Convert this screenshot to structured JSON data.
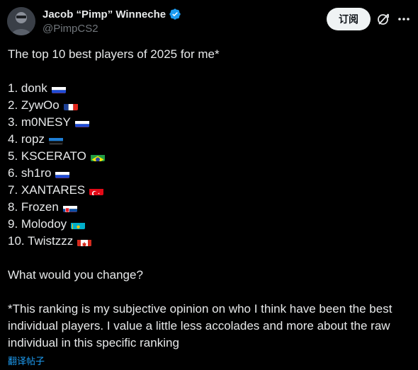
{
  "author": {
    "display_name": "Jacob “Pimp” Winneche",
    "handle": "@PimpCS2",
    "verified_icon": "verified-badge-icon"
  },
  "actions": {
    "subscribe_label": "订阅",
    "grok_icon": "grok-icon",
    "more_icon": "more-icon"
  },
  "post": {
    "intro": "The top 10 best players of 2025 for me*",
    "ranking": [
      {
        "text": "1. donk",
        "flag": "russia"
      },
      {
        "text": "2. ZywOo",
        "flag": "france"
      },
      {
        "text": "3. m0NESY",
        "flag": "russia"
      },
      {
        "text": "4. ropz",
        "flag": "estonia"
      },
      {
        "text": "5. KSCERATO",
        "flag": "brazil"
      },
      {
        "text": "6. sh1ro",
        "flag": "russia"
      },
      {
        "text": "7. XANTARES",
        "flag": "turkey"
      },
      {
        "text": "8. Frozen",
        "flag": "slovakia"
      },
      {
        "text": "9. Molodoy",
        "flag": "kazakhstan"
      },
      {
        "text": "10. Twistzzz",
        "flag": "canada"
      }
    ],
    "question": "What would you change?",
    "footnote": "*This ranking is my subjective opinion on who I think have been the best individual players. I value a little less accolades and more about the raw individual in this specific ranking"
  },
  "translate_label": "翻译帖子",
  "colors": {
    "background": "#000000",
    "text": "#e7e9ea",
    "muted": "#71767b",
    "link": "#1d9bf0",
    "verified": "#1d9bf0"
  }
}
